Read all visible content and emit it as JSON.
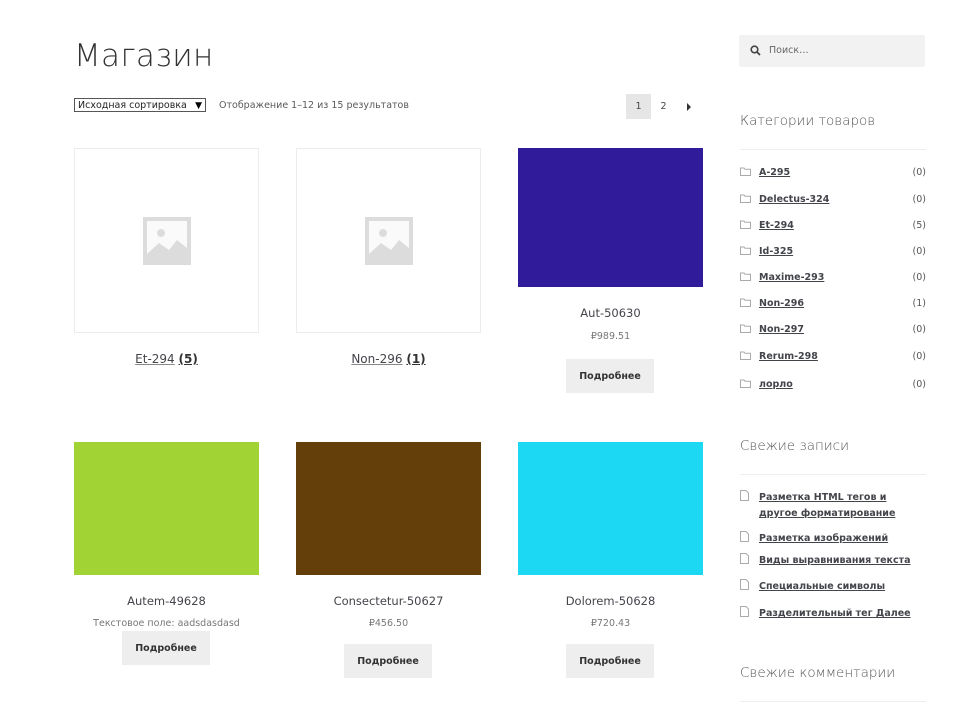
{
  "page": {
    "title": "Магазин"
  },
  "toolbar": {
    "sort_label": "Исходная сортировка",
    "result_count": "Отображение 1–12 из 15 результатов"
  },
  "pagination": {
    "pages": [
      "1",
      "2"
    ],
    "current": "1",
    "next": "→"
  },
  "products": {
    "cat1": {
      "name": "Et-294",
      "count": "(5)"
    },
    "cat2": {
      "name": "Non-296",
      "count": "(1)"
    },
    "p1": {
      "title": "Aut-50630",
      "price": "₽989.51",
      "button": "Подробнее",
      "color": "#301c9a"
    },
    "p2": {
      "title": "Autem-49628",
      "extra": "Текстовое поле: aadsdasdasd",
      "button": "Подробнее",
      "color": "#a0d333"
    },
    "p3": {
      "title": "Consectetur-50627",
      "price": "₽456.50",
      "button": "Подробнее",
      "color": "#643f09"
    },
    "p4": {
      "title": "Dolorem-50628",
      "price": "₽720.43",
      "button": "Подробнее",
      "color": "#1dd8f3"
    }
  },
  "sidebar": {
    "search_placeholder": "Поиск…",
    "categories_title": "Категории товаров",
    "categories": [
      {
        "name": "A-295",
        "count": "(0)"
      },
      {
        "name": "Delectus-324",
        "count": "(0)"
      },
      {
        "name": "Et-294",
        "count": "(5)"
      },
      {
        "name": "Id-325",
        "count": "(0)"
      },
      {
        "name": "Maxime-293",
        "count": "(0)"
      },
      {
        "name": "Non-296",
        "count": "(1)"
      },
      {
        "name": "Non-297",
        "count": "(0)"
      },
      {
        "name": "Rerum-298",
        "count": "(0)"
      },
      {
        "name": "лорло",
        "count": "(0)"
      }
    ],
    "recent_posts_title": "Свежие записи",
    "recent_posts": [
      "Разметка HTML тегов и другое форматирование",
      "Разметка изображений",
      "Виды выравнивания текста",
      "Специальные символы",
      "Разделительный тег Далее"
    ],
    "recent_comments_title": "Свежие комментарии"
  },
  "icons": {
    "placeholder": "image-placeholder-icon",
    "search": "search-icon",
    "folder": "folder-icon",
    "document": "document-icon",
    "next": "arrow-right-icon"
  }
}
